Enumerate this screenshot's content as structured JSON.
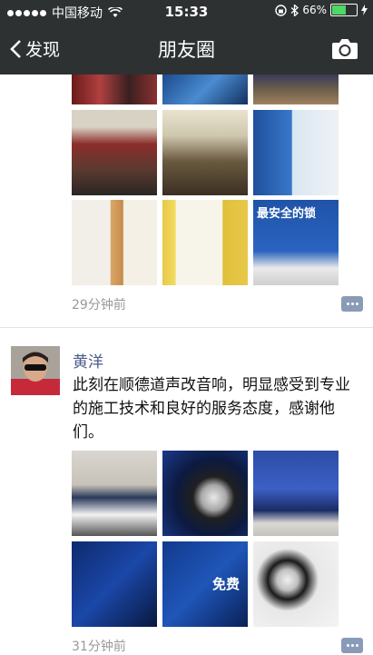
{
  "status": {
    "carrier": "中国移动",
    "time": "15:33",
    "battery": "66%",
    "battery_level": 0.66
  },
  "nav": {
    "back_label": "发现",
    "title": "朋友圈"
  },
  "post1": {
    "time": "29分钟前",
    "photo_captions": [
      "",
      "",
      "",
      "",
      "",
      "",
      "",
      "",
      "最安全的锁"
    ]
  },
  "post2": {
    "author": "黄洋",
    "text": "此刻在顺德道声改音响，明显感受到专业的施工技术和良好的服务态度，感谢他们。",
    "time": "31分钟前",
    "photo_captions": [
      "",
      "",
      "",
      "",
      "",
      "",
      "",
      "免费",
      ""
    ]
  }
}
